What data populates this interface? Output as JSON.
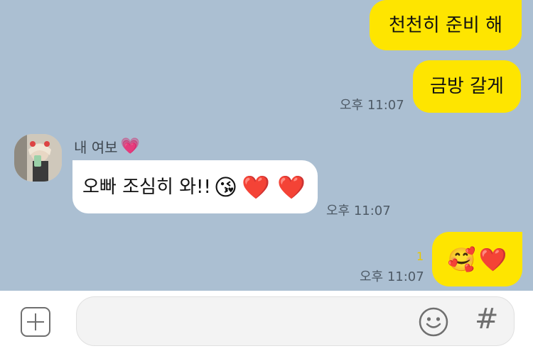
{
  "messages": [
    {
      "id": "m1",
      "text": "천천히 준비 해",
      "time": ""
    },
    {
      "id": "m2",
      "text": "금방 갈게",
      "time": "오후 11:07"
    },
    {
      "id": "m3",
      "sender": "내 여보",
      "sender_emoji": "💗",
      "text": "오빠 조심히 와!!",
      "emojis": "😘",
      "hearts": "❤️ ❤️",
      "time": "오후 11:07"
    },
    {
      "id": "m4",
      "unread": "1",
      "emojis": "🥰",
      "hearts": "❤️",
      "time": "오후 11:07"
    }
  ],
  "input_bar": {
    "plus_icon": "plus-square-icon",
    "placeholder": "",
    "emoji_icon": "smiley-icon",
    "hash_symbol": "#"
  },
  "colors": {
    "background": "#abbfd2",
    "my_bubble": "#fee500",
    "their_bubble": "#ffffff"
  }
}
